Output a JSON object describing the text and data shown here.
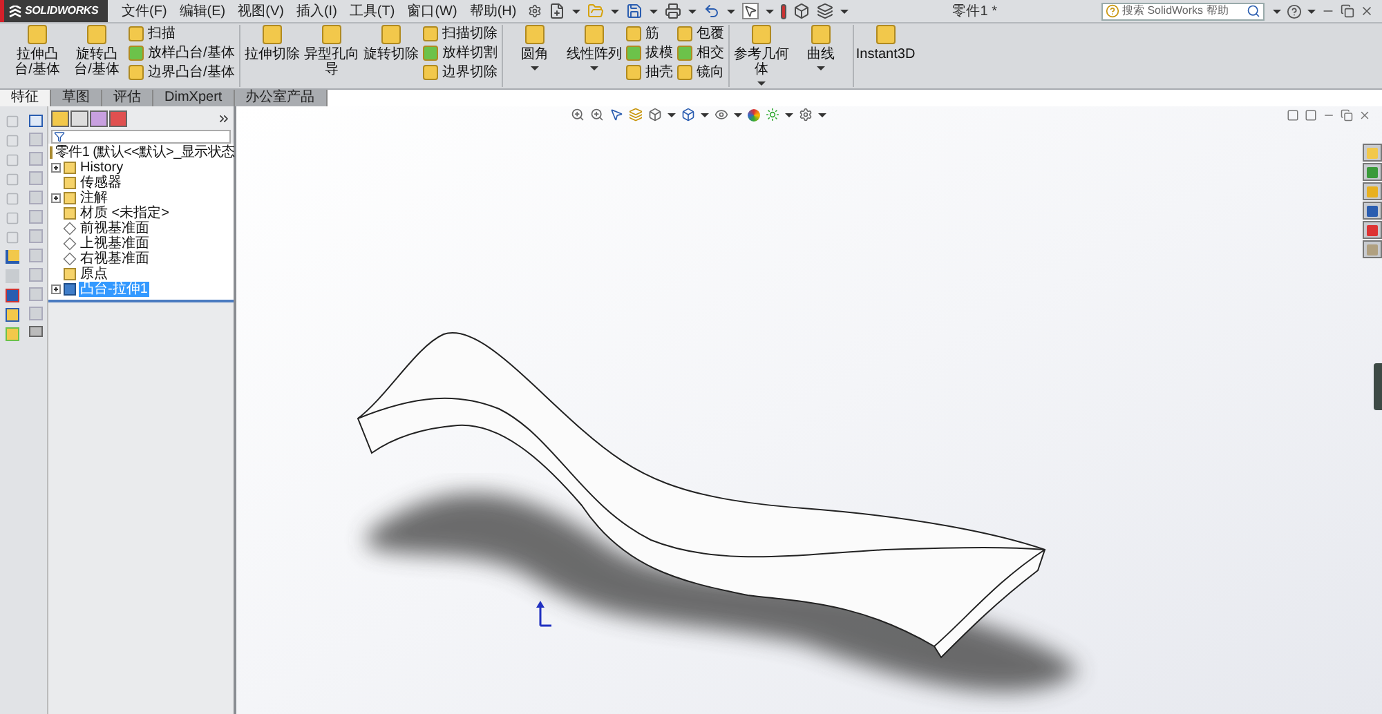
{
  "title_bar": {
    "brand": "SOLIDWORKS",
    "menus": [
      "文件(F)",
      "编辑(E)",
      "视图(V)",
      "插入(I)",
      "工具(T)",
      "窗口(W)",
      "帮助(H)"
    ],
    "document_title": "零件1 *",
    "search": {
      "placeholder": "搜索 SolidWorks 帮助"
    }
  },
  "ribbon": {
    "groups": [
      {
        "items": [
          {
            "kind": "large",
            "label": "拉伸凸台/基体"
          },
          {
            "kind": "large",
            "label": "旋转凸台/基体"
          },
          {
            "kind": "stack",
            "items": [
              "扫描",
              "放样凸台/基体",
              "边界凸台/基体"
            ]
          }
        ]
      },
      {
        "items": [
          {
            "kind": "large",
            "label": "拉伸切除"
          },
          {
            "kind": "large",
            "label": "异型孔向导"
          },
          {
            "kind": "large",
            "label": "旋转切除"
          },
          {
            "kind": "stack",
            "items": [
              "扫描切除",
              "放样切割",
              "边界切除"
            ]
          }
        ]
      },
      {
        "items": [
          {
            "kind": "dropdown",
            "label": "圆角"
          },
          {
            "kind": "dropdown",
            "label": "线性阵列"
          },
          {
            "kind": "stack",
            "items": [
              "筋",
              "拔模",
              "抽壳"
            ]
          },
          {
            "kind": "stack",
            "items": [
              "包覆",
              "相交",
              "镜向"
            ]
          }
        ]
      },
      {
        "items": [
          {
            "kind": "dropdown",
            "label": "参考几何体"
          },
          {
            "kind": "dropdown",
            "label": "曲线"
          }
        ]
      },
      {
        "items": [
          {
            "kind": "large",
            "label": "Instant3D"
          }
        ]
      }
    ]
  },
  "tabs": [
    {
      "label": "特征",
      "selected": true
    },
    {
      "label": "草图",
      "selected": false
    },
    {
      "label": "评估",
      "selected": false
    },
    {
      "label": "DimXpert",
      "selected": false
    },
    {
      "label": "办公室产品",
      "selected": false
    }
  ],
  "feature_tree": {
    "root": "零件1 (默认<<默认>_显示状态",
    "items": [
      {
        "label": "History",
        "expanded": false,
        "selected": false
      },
      {
        "label": "传感器",
        "selected": false
      },
      {
        "label": "注解",
        "expanded": false,
        "selected": false
      },
      {
        "label": "材质 <未指定>",
        "selected": false
      },
      {
        "label": "前视基准面",
        "selected": false
      },
      {
        "label": "上视基准面",
        "selected": false
      },
      {
        "label": "右视基准面",
        "selected": false
      },
      {
        "label": "原点",
        "selected": false
      },
      {
        "label": "凸台-拉伸1",
        "expanded": false,
        "selected": true
      }
    ]
  }
}
